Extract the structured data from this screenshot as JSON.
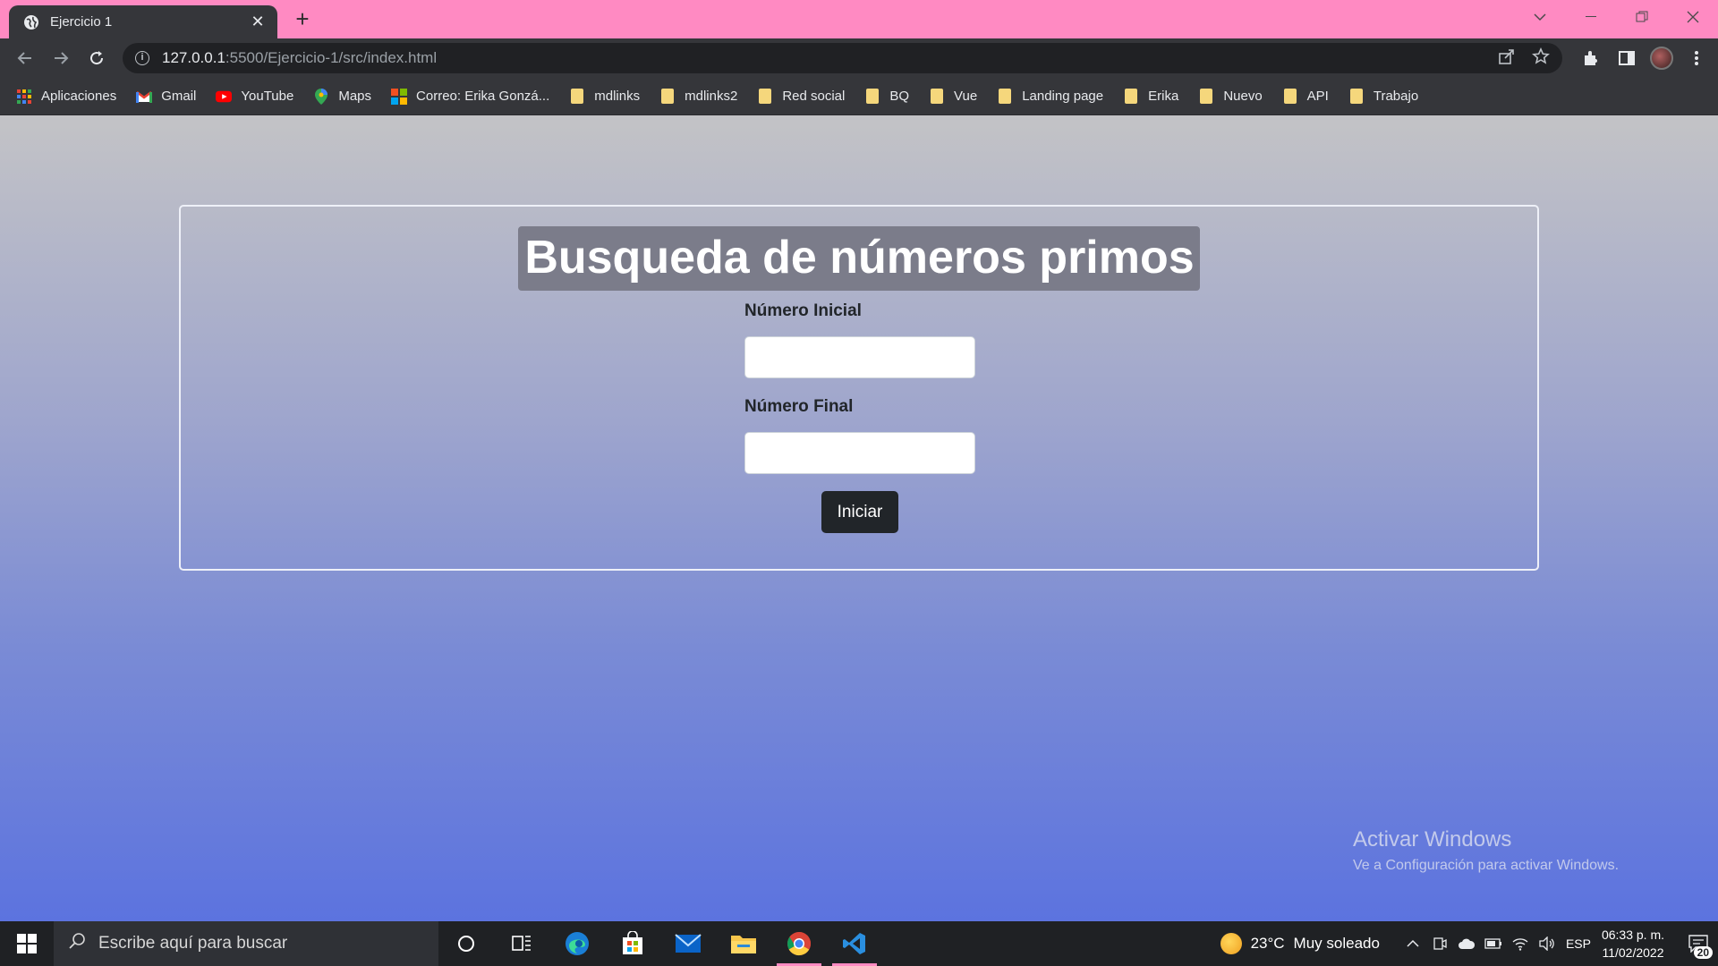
{
  "browser": {
    "tab": {
      "title": "Ejercicio 1"
    },
    "address": {
      "host": "127.0.0.1",
      "rest": ":5500/Ejercicio-1/src/index.html"
    },
    "bookmarks": [
      {
        "label": "Aplicaciones",
        "icon": "apps-grid-icon"
      },
      {
        "label": "Gmail",
        "icon": "gmail-icon"
      },
      {
        "label": "YouTube",
        "icon": "youtube-icon"
      },
      {
        "label": "Maps",
        "icon": "maps-pin-icon"
      },
      {
        "label": "Correo: Erika Gonzá...",
        "icon": "microsoft-icon"
      },
      {
        "label": "mdlinks",
        "icon": "folder-icon"
      },
      {
        "label": "mdlinks2",
        "icon": "folder-icon"
      },
      {
        "label": "Red social",
        "icon": "folder-icon"
      },
      {
        "label": "BQ",
        "icon": "folder-icon"
      },
      {
        "label": "Vue",
        "icon": "folder-icon"
      },
      {
        "label": "Landing page",
        "icon": "folder-icon"
      },
      {
        "label": "Erika",
        "icon": "folder-icon"
      },
      {
        "label": "Nuevo",
        "icon": "folder-icon"
      },
      {
        "label": "API",
        "icon": "folder-icon"
      },
      {
        "label": "Trabajo",
        "icon": "folder-icon"
      }
    ]
  },
  "page": {
    "heading": "Busqueda de números primos",
    "start_label": "Número Inicial",
    "start_value": "",
    "end_label": "Número Final",
    "end_value": "",
    "submit_label": "Iniciar"
  },
  "watermark": {
    "title": "Activar Windows",
    "subtitle": "Ve a Configuración para activar Windows."
  },
  "taskbar": {
    "search_placeholder": "Escribe aquí para buscar",
    "weather_temp": "23°C",
    "weather_desc": "Muy soleado",
    "language": "ESP",
    "time": "06:33 p. m.",
    "date": "11/02/2022",
    "notification_count": "20"
  },
  "colors": {
    "tab_strip": "#ff8ac2",
    "chrome_dark": "#35363a",
    "heading_bg": "#7b7c8a",
    "button_bg": "#212529"
  }
}
